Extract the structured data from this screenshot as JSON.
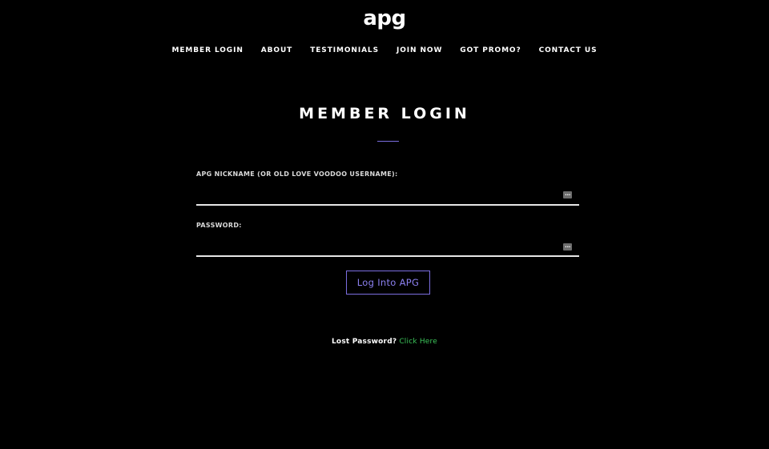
{
  "header": {
    "logo_text": "apg"
  },
  "nav": {
    "items": [
      {
        "label": "MEMBER LOGIN"
      },
      {
        "label": "ABOUT"
      },
      {
        "label": "TESTIMONIALS"
      },
      {
        "label": "JOIN NOW"
      },
      {
        "label": "GOT PROMO?"
      },
      {
        "label": "CONTACT US"
      }
    ]
  },
  "main": {
    "title": "MEMBER LOGIN",
    "nickname_label": "APG NICKNAME (OR OLD LOVE VOODOO USERNAME):",
    "nickname_value": "",
    "password_label": "PASSWORD:",
    "password_value": "",
    "login_button": "Log Into APG",
    "lost_password_text": "Lost Password?",
    "lost_password_link": "Click Here"
  },
  "icons": {
    "field_icon": "password-manager-icon",
    "field_icon_glyph": "…"
  },
  "colors": {
    "background": "#000000",
    "accent": "#7b6ee0",
    "link": "#3cc55a"
  }
}
